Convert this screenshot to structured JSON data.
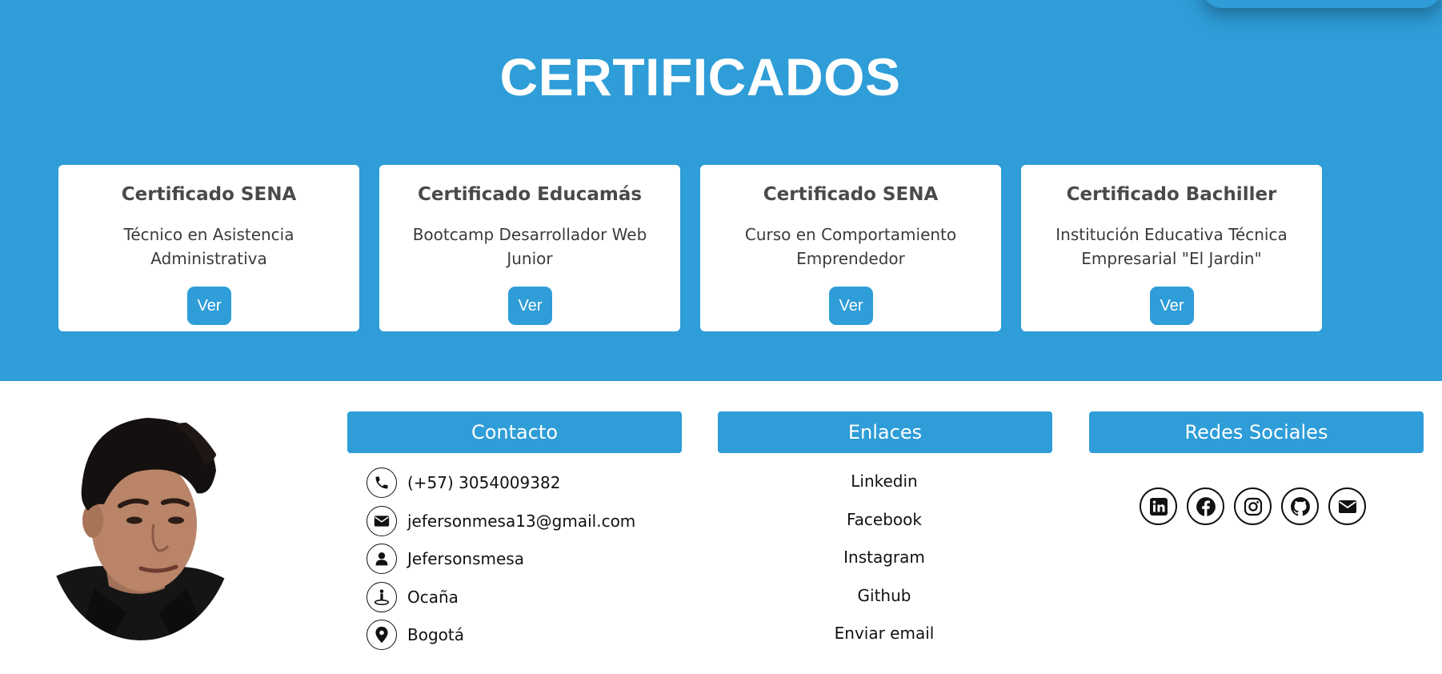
{
  "certificates": {
    "title": "CERTIFICADOS",
    "cards": [
      {
        "title": "Certificado SENA",
        "description": "Técnico en Asistencia Administrativa",
        "button": "Ver"
      },
      {
        "title": "Certificado Educamás",
        "description": "Bootcamp Desarrollador Web Junior",
        "button": "Ver"
      },
      {
        "title": "Certificado SENA",
        "description": "Curso en Comportamiento Emprendedor",
        "button": "Ver"
      },
      {
        "title": "Certificado Bachiller",
        "description": "Institución Educativa Técnica Empresarial \"El Jardin\"",
        "button": "Ver"
      }
    ]
  },
  "footer": {
    "contact": {
      "heading": "Contacto",
      "items": [
        {
          "icon": "phone-icon",
          "text": "(+57) 3054009382"
        },
        {
          "icon": "email-icon",
          "text": "jefersonmesa13@gmail.com"
        },
        {
          "icon": "user-icon",
          "text": "Jefersonsmesa"
        },
        {
          "icon": "location-person-icon",
          "text": "Ocaña"
        },
        {
          "icon": "map-pin-icon",
          "text": "Bogotá"
        }
      ]
    },
    "links": {
      "heading": "Enlaces",
      "items": [
        "Linkedin",
        "Facebook",
        "Instagram",
        "Github",
        "Enviar email"
      ]
    },
    "social": {
      "heading": "Redes Sociales",
      "icons": [
        "linkedin-icon",
        "facebook-icon",
        "instagram-icon",
        "github-icon",
        "email-icon"
      ]
    }
  },
  "colors": {
    "accent": "#2e9dd8",
    "card_background": "#ffffff",
    "text_dark": "#111111"
  }
}
